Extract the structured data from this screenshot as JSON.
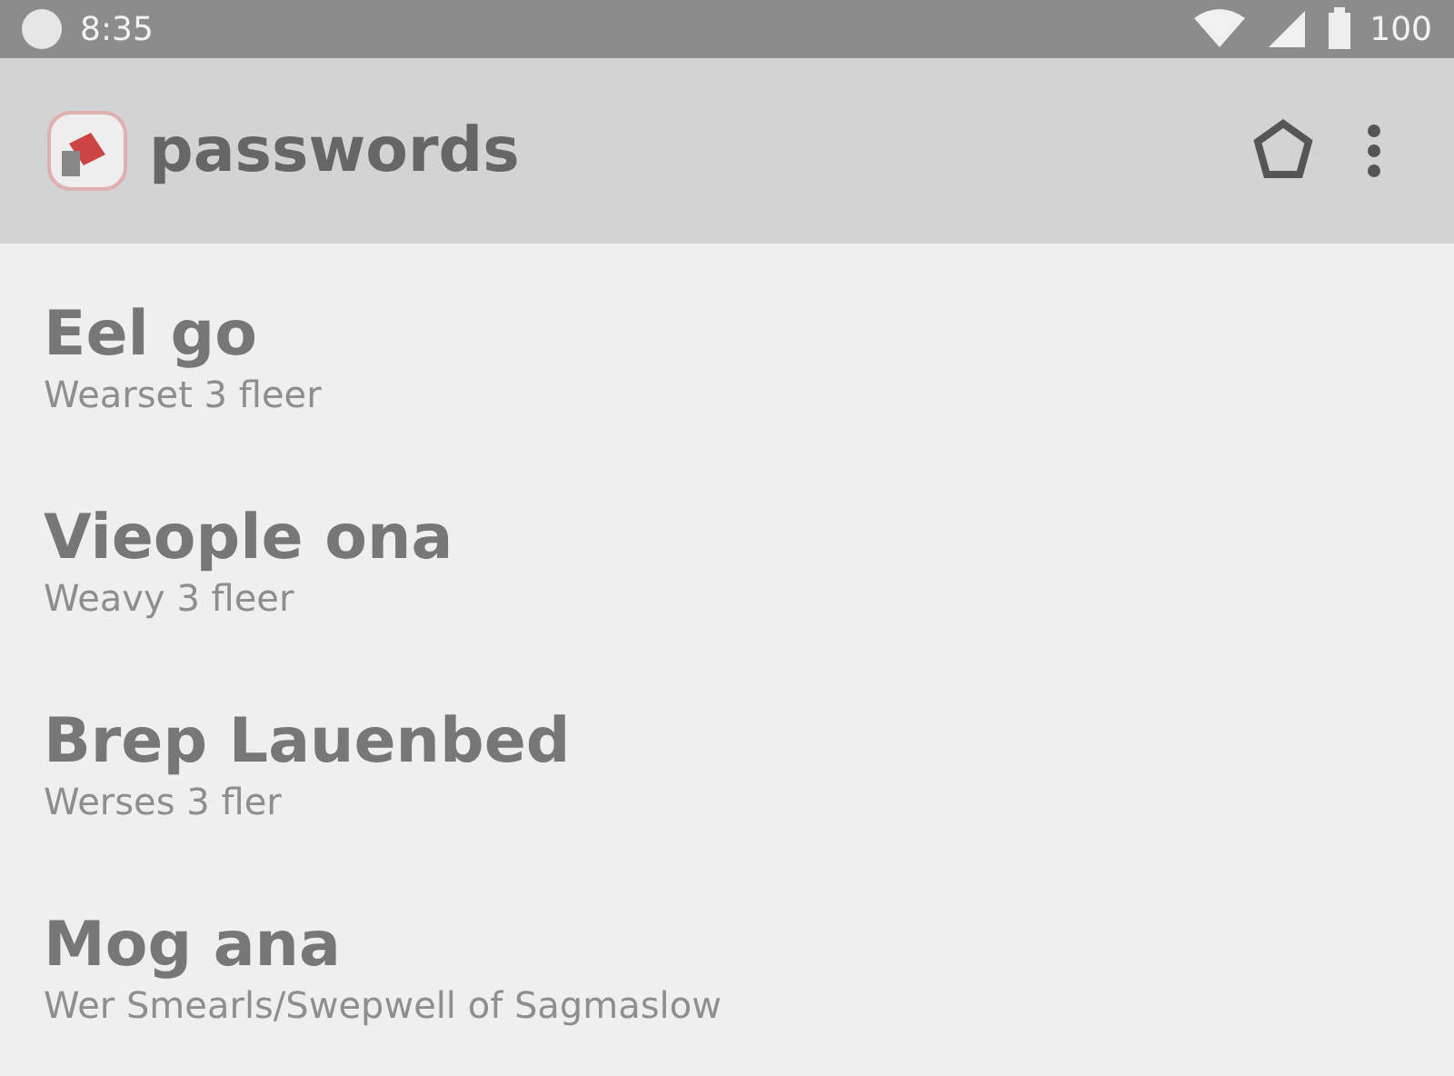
{
  "status_bar": {
    "time": "8:35",
    "battery": "100"
  },
  "toolbar": {
    "title": "passwords"
  },
  "list": [
    {
      "title": "Eel go",
      "subtitle": "Wearset 3 fleer"
    },
    {
      "title": "Vieople ona",
      "subtitle": "Weavy 3 fleer"
    },
    {
      "title": "Brep Lauenbed",
      "subtitle": "Werses 3 fler"
    },
    {
      "title": "Mog ana",
      "subtitle": "Wer Smearls/Swepwell of Sagmaslow"
    }
  ]
}
